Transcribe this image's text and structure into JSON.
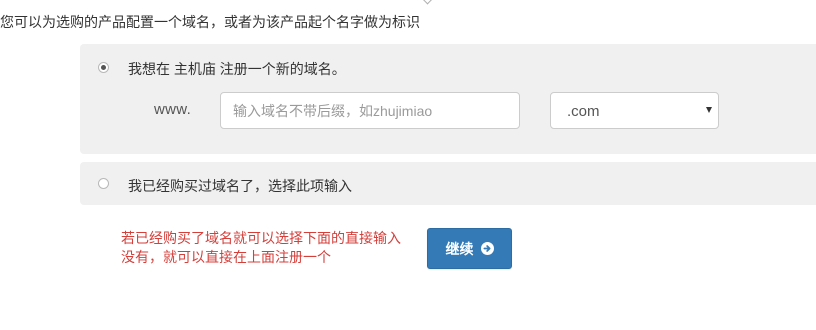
{
  "intro_text": "您可以为选购的产品配置一个域名，或者为该产品起个名字做为标识",
  "register_option": {
    "label": "我想在 主机庙 注册一个新的域名。",
    "selected": true,
    "www_label": "www.",
    "domain_input": {
      "value": "",
      "placeholder": "输入域名不带后缀，如zhujimiao"
    },
    "tld_select": {
      "selected": ".com"
    }
  },
  "existing_option": {
    "label": "我已经购买过域名了，选择此项输入",
    "selected": false
  },
  "note": {
    "line1": "若已经购买了域名就可以选择下面的直接输入",
    "line2": "没有，就可以直接在上面注册一个",
    "color": "#d43f3a"
  },
  "continue_button": {
    "label": "继续",
    "icon": "arrow-circle-right-icon",
    "color": "#337ab7"
  }
}
